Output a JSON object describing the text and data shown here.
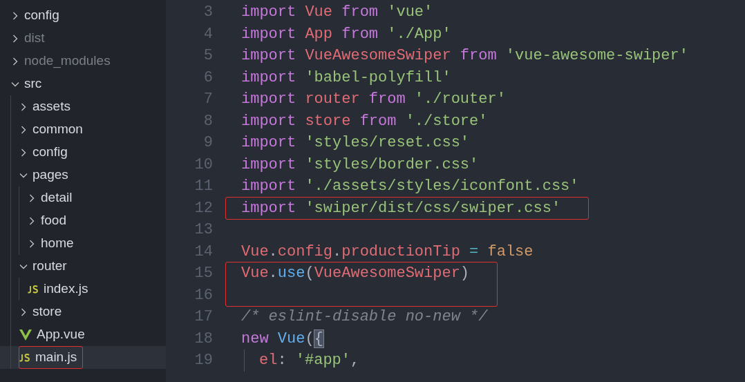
{
  "explorer": {
    "items": [
      {
        "label": "config",
        "kind": "folder",
        "expanded": false,
        "ignored": false,
        "selected": false,
        "boxed": false
      },
      {
        "label": "dist",
        "kind": "folder",
        "expanded": false,
        "ignored": true,
        "selected": false,
        "boxed": false
      },
      {
        "label": "node_modules",
        "kind": "folder",
        "expanded": false,
        "ignored": true,
        "selected": false,
        "boxed": false
      },
      {
        "label": "src",
        "kind": "folder",
        "expanded": true,
        "ignored": false,
        "selected": false,
        "boxed": false,
        "children": [
          {
            "label": "assets",
            "kind": "folder",
            "expanded": false,
            "ignored": false,
            "selected": false,
            "boxed": false
          },
          {
            "label": "common",
            "kind": "folder",
            "expanded": false,
            "ignored": false,
            "selected": false,
            "boxed": false
          },
          {
            "label": "config",
            "kind": "folder",
            "expanded": false,
            "ignored": false,
            "selected": false,
            "boxed": false
          },
          {
            "label": "pages",
            "kind": "folder",
            "expanded": true,
            "ignored": false,
            "selected": false,
            "boxed": false,
            "children": [
              {
                "label": "detail",
                "kind": "folder",
                "expanded": false,
                "ignored": false,
                "selected": false,
                "boxed": false
              },
              {
                "label": "food",
                "kind": "folder",
                "expanded": false,
                "ignored": false,
                "selected": false,
                "boxed": false
              },
              {
                "label": "home",
                "kind": "folder",
                "expanded": false,
                "ignored": false,
                "selected": false,
                "boxed": false
              }
            ]
          },
          {
            "label": "router",
            "kind": "folder",
            "expanded": true,
            "ignored": false,
            "selected": false,
            "boxed": false,
            "children": [
              {
                "label": "index.js",
                "kind": "js",
                "ignored": false,
                "selected": false,
                "boxed": false
              }
            ]
          },
          {
            "label": "store",
            "kind": "folder",
            "expanded": false,
            "ignored": false,
            "selected": false,
            "boxed": false
          },
          {
            "label": "App.vue",
            "kind": "vue",
            "ignored": false,
            "selected": false,
            "boxed": false
          },
          {
            "label": "main.js",
            "kind": "js",
            "ignored": false,
            "selected": true,
            "boxed": true
          }
        ]
      }
    ]
  },
  "editor": {
    "lines": [
      {
        "number": "3",
        "tokens": [
          {
            "kind": "keyword",
            "text": "import"
          },
          {
            "kind": "variable",
            "text": " Vue"
          },
          {
            "kind": "keyword",
            "text": " from"
          },
          {
            "kind": "string",
            "text": " 'vue'"
          }
        ]
      },
      {
        "number": "4",
        "tokens": [
          {
            "kind": "keyword",
            "text": "import"
          },
          {
            "kind": "variable",
            "text": " App"
          },
          {
            "kind": "keyword",
            "text": " from"
          },
          {
            "kind": "string",
            "text": " './App'"
          }
        ]
      },
      {
        "number": "5",
        "tokens": [
          {
            "kind": "keyword",
            "text": "import"
          },
          {
            "kind": "variable",
            "text": " VueAwesomeSwiper"
          },
          {
            "kind": "keyword",
            "text": " from"
          },
          {
            "kind": "string",
            "text": " 'vue-awesome-swiper'"
          }
        ]
      },
      {
        "number": "6",
        "tokens": [
          {
            "kind": "keyword",
            "text": "import"
          },
          {
            "kind": "string",
            "text": " 'babel-polyfill'"
          }
        ]
      },
      {
        "number": "7",
        "tokens": [
          {
            "kind": "keyword",
            "text": "import"
          },
          {
            "kind": "variable",
            "text": " router"
          },
          {
            "kind": "keyword",
            "text": " from"
          },
          {
            "kind": "string",
            "text": " './router'"
          }
        ]
      },
      {
        "number": "8",
        "tokens": [
          {
            "kind": "keyword",
            "text": "import"
          },
          {
            "kind": "variable",
            "text": " store"
          },
          {
            "kind": "keyword",
            "text": " from"
          },
          {
            "kind": "string",
            "text": " './store'"
          }
        ]
      },
      {
        "number": "9",
        "tokens": [
          {
            "kind": "keyword",
            "text": "import"
          },
          {
            "kind": "string",
            "text": " 'styles/reset.css'"
          }
        ]
      },
      {
        "number": "10",
        "tokens": [
          {
            "kind": "keyword",
            "text": "import"
          },
          {
            "kind": "string",
            "text": " 'styles/border.css'"
          }
        ]
      },
      {
        "number": "11",
        "tokens": [
          {
            "kind": "keyword",
            "text": "import"
          },
          {
            "kind": "string",
            "text": " './assets/styles/iconfont.css'"
          }
        ]
      },
      {
        "number": "12",
        "boxed": true,
        "tokens": [
          {
            "kind": "keyword",
            "text": "import"
          },
          {
            "kind": "string",
            "text": " 'swiper/dist/css/swiper.css'"
          }
        ]
      },
      {
        "number": "13"
      },
      {
        "number": "14",
        "tokens": [
          {
            "kind": "variable",
            "text": "Vue"
          },
          {
            "kind": "plain",
            "text": "."
          },
          {
            "kind": "variable",
            "text": "config"
          },
          {
            "kind": "plain",
            "text": "."
          },
          {
            "kind": "variable",
            "text": "productionTip"
          },
          {
            "kind": "operator",
            "text": " ="
          },
          {
            "kind": "boolean",
            "text": " false"
          }
        ]
      },
      {
        "number": "15",
        "boxed": true,
        "tokens": [
          {
            "kind": "variable",
            "text": "Vue"
          },
          {
            "kind": "plain",
            "text": "."
          },
          {
            "kind": "function",
            "text": "use"
          },
          {
            "kind": "plain",
            "text": "("
          },
          {
            "kind": "variable",
            "text": "VueAwesomeSwiper"
          },
          {
            "kind": "plain",
            "text": ")"
          }
        ]
      },
      {
        "number": "16",
        "boxed": true
      },
      {
        "number": "17",
        "tokens": [
          {
            "kind": "comment",
            "text": "/* eslint-disable no-new */"
          }
        ]
      },
      {
        "number": "18",
        "tokens": [
          {
            "kind": "keyword",
            "text": "new"
          },
          {
            "kind": "function",
            "text": " Vue"
          },
          {
            "kind": "plain",
            "text": "("
          },
          {
            "kind": "bracket_match",
            "text": "{"
          }
        ]
      },
      {
        "number": "19",
        "indent": true,
        "tokens": [
          {
            "kind": "variable",
            "text": "el"
          },
          {
            "kind": "plain",
            "text": ":"
          },
          {
            "kind": "string",
            "text": " '#app'"
          },
          {
            "kind": "plain",
            "text": ","
          }
        ]
      }
    ]
  }
}
